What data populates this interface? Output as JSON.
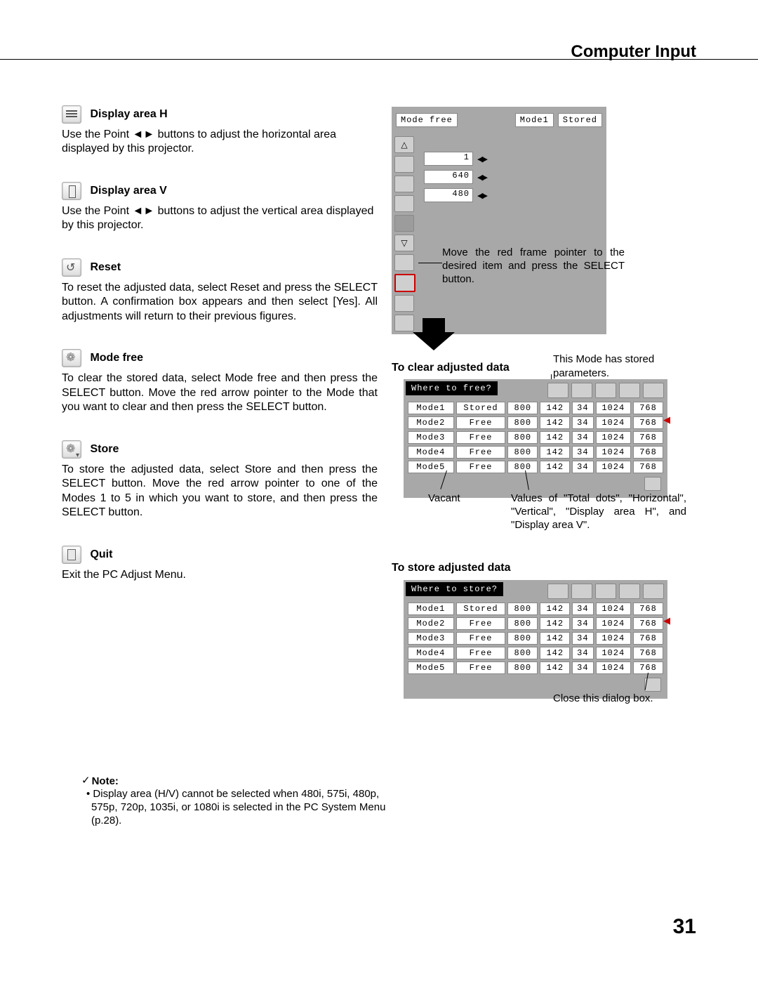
{
  "header": {
    "title": "Computer Input"
  },
  "page_number": "31",
  "sections": [
    {
      "id": "disp-h",
      "title": "Display area H",
      "body": "Use the Point ◄► buttons to adjust the horizontal area displayed by this projector."
    },
    {
      "id": "disp-v",
      "title": "Display area V",
      "body": "Use the Point ◄► buttons to adjust the vertical area displayed by this projector."
    },
    {
      "id": "reset",
      "title": "Reset",
      "body": "To reset the adjusted data, select Reset and press the SELECT button. A confirmation box appears and then select [Yes]. All adjustments will return to their previous figures."
    },
    {
      "id": "mode-free",
      "title": "Mode free",
      "body": "To clear the stored data, select Mode free and then press the SELECT button. Move the red arrow pointer to the Mode that you want to clear and then press the SELECT button."
    },
    {
      "id": "store",
      "title": "Store",
      "body": "To store the adjusted data, select Store and then press the SELECT button. Move the red arrow pointer to one of the Modes 1 to 5 in which you want to store, and then press the SELECT button."
    },
    {
      "id": "quit",
      "title": "Quit",
      "body": "Exit the PC Adjust Menu."
    }
  ],
  "note": {
    "head": "Note:",
    "body": "• Display area (H/V) cannot be selected when 480i, 575i, 480p, 575p, 720p, 1035i, or 1080i is selected in the PC System Menu (p.28)."
  },
  "osd_top": {
    "title": "Mode free",
    "right1": "Mode1",
    "right2": "Stored",
    "values": {
      "sync": "1",
      "h": "640",
      "v": "480"
    }
  },
  "hint_pointer": "Move the red frame pointer to the desired item and press the SELECT button.",
  "label_clear": "To clear adjusted data",
  "label_store": "To store adjusted data",
  "hint_stored": "This Mode has stored parameters.",
  "table_free": {
    "title": "Where to free?",
    "rows": [
      {
        "name": "Mode1",
        "status": "Stored",
        "a": "800",
        "b": "142",
        "c": "34",
        "d": "1024",
        "e": "768"
      },
      {
        "name": "Mode2",
        "status": "Free",
        "a": "800",
        "b": "142",
        "c": "34",
        "d": "1024",
        "e": "768"
      },
      {
        "name": "Mode3",
        "status": "Free",
        "a": "800",
        "b": "142",
        "c": "34",
        "d": "1024",
        "e": "768"
      },
      {
        "name": "Mode4",
        "status": "Free",
        "a": "800",
        "b": "142",
        "c": "34",
        "d": "1024",
        "e": "768"
      },
      {
        "name": "Mode5",
        "status": "Free",
        "a": "800",
        "b": "142",
        "c": "34",
        "d": "1024",
        "e": "768"
      }
    ]
  },
  "table_store": {
    "title": "Where to store?",
    "rows": [
      {
        "name": "Mode1",
        "status": "Stored",
        "a": "800",
        "b": "142",
        "c": "34",
        "d": "1024",
        "e": "768"
      },
      {
        "name": "Mode2",
        "status": "Free",
        "a": "800",
        "b": "142",
        "c": "34",
        "d": "1024",
        "e": "768"
      },
      {
        "name": "Mode3",
        "status": "Free",
        "a": "800",
        "b": "142",
        "c": "34",
        "d": "1024",
        "e": "768"
      },
      {
        "name": "Mode4",
        "status": "Free",
        "a": "800",
        "b": "142",
        "c": "34",
        "d": "1024",
        "e": "768"
      },
      {
        "name": "Mode5",
        "status": "Free",
        "a": "800",
        "b": "142",
        "c": "34",
        "d": "1024",
        "e": "768"
      }
    ]
  },
  "annot": {
    "vacant": "Vacant",
    "values_desc": "Values of \"Total dots\", \"Horizontal\", \"Vertical\", \"Display area H\", and \"Display area V\".",
    "close": "Close this dialog box."
  }
}
